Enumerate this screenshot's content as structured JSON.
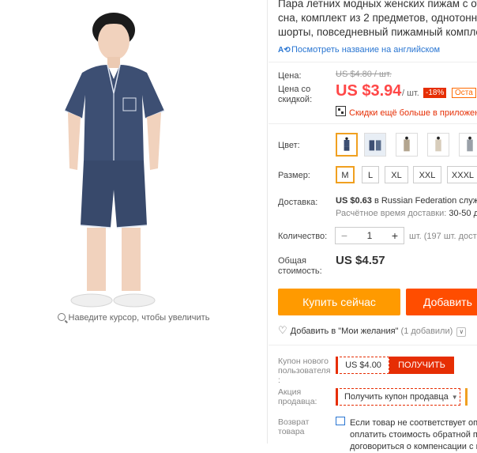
{
  "product": {
    "title_lines": [
      "Пара летних модных женских пижам с от",
      "сна, комплект из 2 предметов, однотонн",
      "шорты, повседневный пижамный компле"
    ],
    "translate_link": "Посмотреть название на английском",
    "zoom_hint": "Наведите курсор, чтобы увеличить"
  },
  "price": {
    "price_label": "Цена:",
    "old_price": "US $4.80 / шт.",
    "discount_label_1": "Цена со",
    "discount_label_2": "скидкой:",
    "current_price": "US $3.94",
    "per_unit": "/ шт.",
    "discount_badge": "-18%",
    "remaining_badge": "Оста",
    "app_promo": "Скидки ещё больше в приложени"
  },
  "options": {
    "color_label": "Цвет:",
    "size_label": "Размер:",
    "sizes": [
      "M",
      "L",
      "XL",
      "XXL",
      "XXXL"
    ],
    "selected_size": "M"
  },
  "shipping": {
    "label": "Доставка:",
    "price": "US $0.63",
    "destination": "в Russian Federation служ",
    "time_label": "Расчётное время доставки:",
    "time_value": "30-50 д"
  },
  "quantity": {
    "label": "Количество:",
    "value": "1",
    "minus": "−",
    "plus": "+",
    "info": "шт. (197 шт. досту"
  },
  "total": {
    "label_1": "Общая",
    "label_2": "стоимость:",
    "value": "US $4.57"
  },
  "actions": {
    "buy_now": "Купить сейчас",
    "add_to_cart": "Добавить"
  },
  "wishlist": {
    "label": "Добавить в \"Мои желания\"",
    "count": "(1 добавили)",
    "chevron": "∨"
  },
  "coupons": {
    "new_user_label_1": "Купон нового",
    "new_user_label_2": "пользователя",
    "new_user_label_3": ":",
    "amount": "US $4.00",
    "get_button": "ПОЛУЧИТЬ",
    "seller_label_1": "Акция",
    "seller_label_2": "продавца:",
    "seller_coupon": "Получить купон продавца",
    "seller_arrow": "▼"
  },
  "returns": {
    "label_1": "Возврат",
    "label_2": "товара",
    "lines": [
      "Если товар не соответствует опис",
      "оплатить стоимость обратной пер",
      "договориться о компенсации с п"
    ]
  },
  "colors": {
    "accent_orange": "#ff9a00",
    "accent_red": "#ff4747",
    "pajama_navy": "#3d4f73",
    "link_blue": "#2a76d2"
  }
}
